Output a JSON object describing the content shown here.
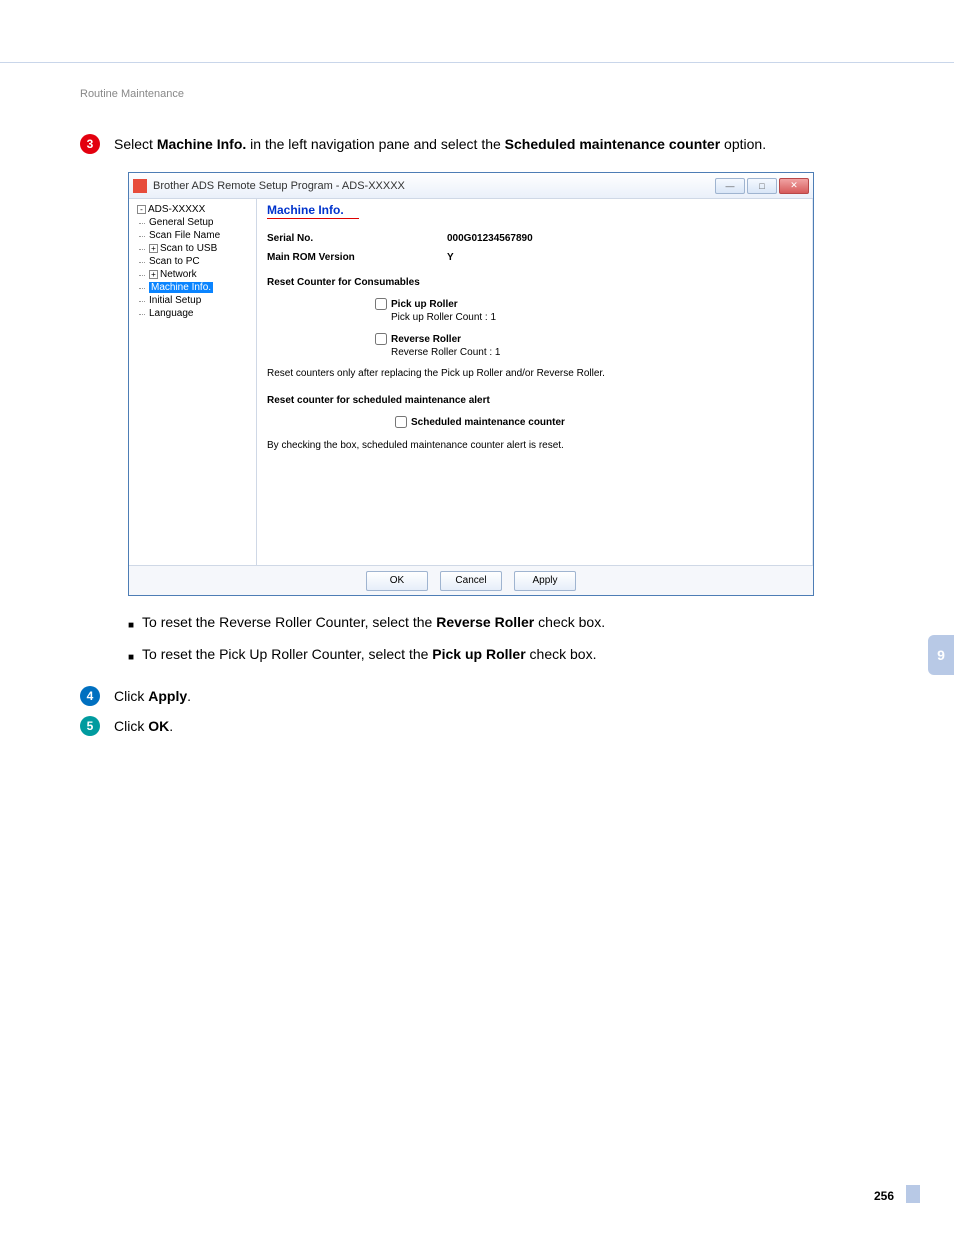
{
  "header": "Routine Maintenance",
  "steps": {
    "s3": {
      "pre": "Select ",
      "bold1": "Machine Info.",
      "mid": " in the left navigation pane and select the ",
      "bold2": "Scheduled maintenance counter",
      "post": " option."
    },
    "s4": {
      "pre": "Click ",
      "bold": "Apply",
      "post": "."
    },
    "s5": {
      "pre": "Click ",
      "bold": "OK",
      "post": "."
    }
  },
  "bullets": {
    "b1": {
      "pre": "To reset the Reverse Roller Counter, select the ",
      "bold": "Reverse Roller",
      "post": " check box."
    },
    "b2": {
      "pre": "To reset the Pick Up Roller Counter, select the ",
      "bold": "Pick up Roller",
      "post": " check box."
    }
  },
  "window": {
    "title": "Brother ADS Remote Setup Program - ADS-XXXXX",
    "tree": {
      "root": "ADS-XXXXX",
      "items": [
        "General Setup",
        "Scan File Name",
        "Scan to USB",
        "Scan to PC",
        "Network",
        "Machine Info.",
        "Initial Setup",
        "Language"
      ]
    },
    "panel": {
      "title": "Machine Info.",
      "serial_label": "Serial No.",
      "serial_value": "000G01234567890",
      "rom_label": "Main ROM Version",
      "rom_value": "Y",
      "reset_consumables": "Reset Counter for Consumables",
      "pickup_label": "Pick up Roller",
      "pickup_count": "Pick up Roller Count : 1",
      "reverse_label": "Reverse Roller",
      "reverse_count": "Reverse Roller Count : 1",
      "consumables_note": "Reset counters only after replacing the Pick up Roller and/or Reverse Roller.",
      "reset_sched": "Reset counter for scheduled maintenance alert",
      "sched_label": "Scheduled maintenance counter",
      "sched_note": "By checking the box, scheduled maintenance counter alert is reset."
    },
    "buttons": {
      "ok": "OK",
      "cancel": "Cancel",
      "apply": "Apply"
    }
  },
  "side_tab": "9",
  "page_number": "256"
}
